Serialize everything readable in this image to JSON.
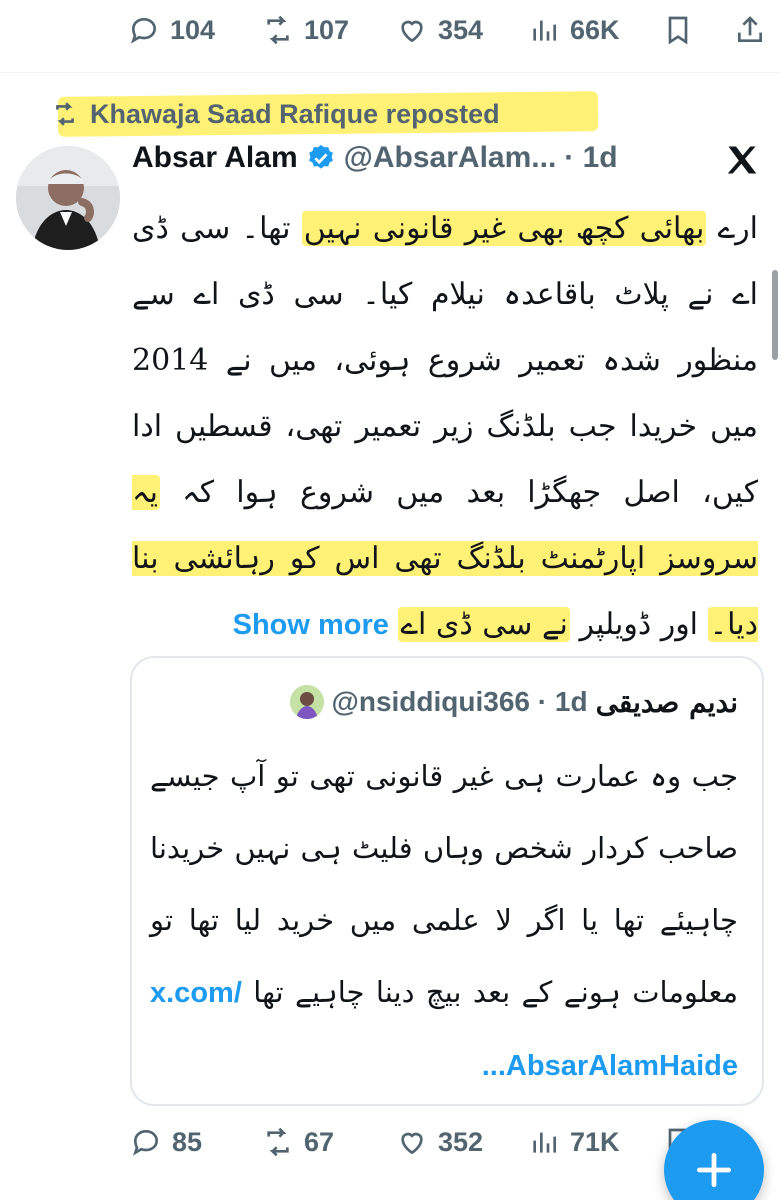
{
  "top_actions": {
    "replies": "104",
    "reposts": "107",
    "likes": "354",
    "views": "66K"
  },
  "repost_banner": {
    "text": "Khawaja Saad Rafique reposted"
  },
  "tweet": {
    "name": "Absar Alam",
    "handle": "@AbsarAlam...",
    "time": "· 1d",
    "body": {
      "p1": "ارے ",
      "hl1": "بھائی کچھ بھی غیر قانونی نہیں",
      "p2": " تھا۔ سی ڈی اے نے پلاٹ باقاعدہ نیلام کیا۔ سی ڈی اے سے منظور شدہ تعمیر شروع ہوئی، میں نے 2014 میں خریدا جب بلڈنگ زیر تعمیر تھی، قسطیں ادا کیں، اصل جھگڑا بعد میں شروع ہوا کہ ",
      "hl2": "یہ سروسز اپارٹمنٹ بلڈنگ تھی اس کو رہائشی بنا دیا۔",
      "p3": " اور ڈویلپر ",
      "hl3": "نے سی ڈی اے",
      "show_more": "Show more"
    },
    "quote": {
      "name": "ندیم صدیقی",
      "handle": "@nsiddiqui366 · 1d",
      "text": "جب وہ عمارت ہی غیر قانونی تھی تو آپ جیسے صاحب کردار شخص وہاں فلیٹ ہی نہیں خریدنا چاہیئے تھا یا اگر لا علمی میں خرید لیا تھا تو معلومات ہونے کے بعد بیچ دینا چاہیے تھا",
      "link": "x.com/ ...AbsarAlamHaide"
    }
  },
  "bottom_actions": {
    "replies": "85",
    "reposts": "67",
    "likes": "352",
    "views": "71K"
  },
  "colors": {
    "accent": "#1d9bf0",
    "highlight": "#fff176",
    "muted": "#536471"
  }
}
